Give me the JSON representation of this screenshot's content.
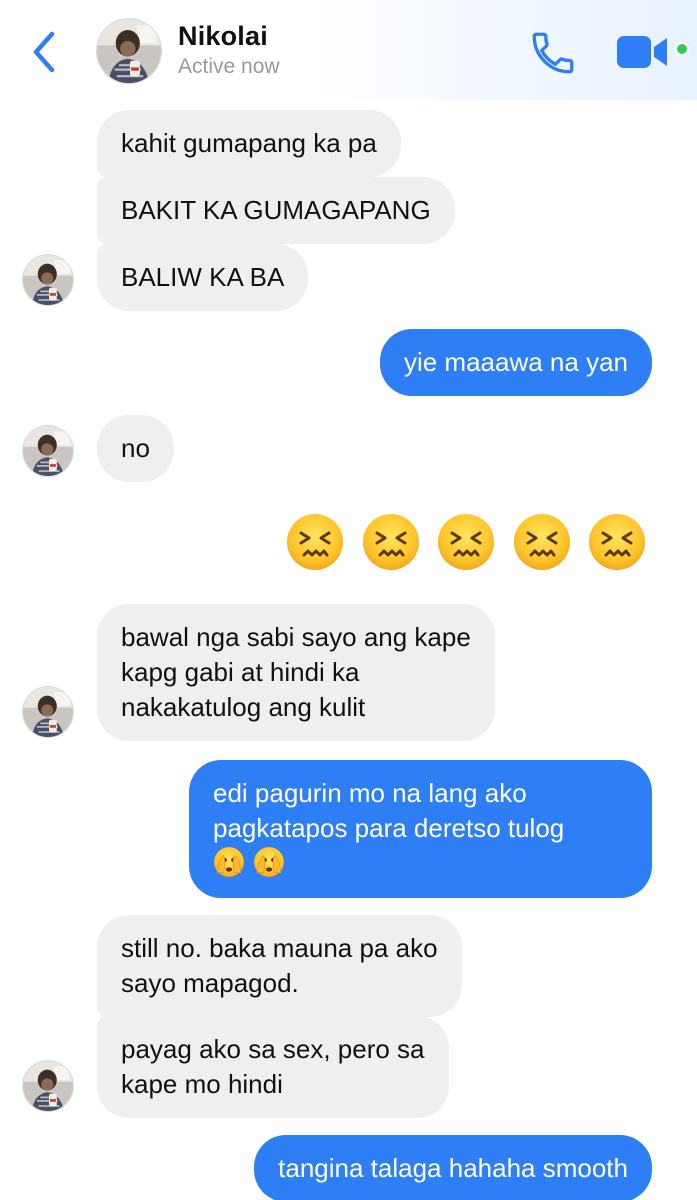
{
  "header": {
    "contact_name": "Nikolai",
    "status": "Active now"
  },
  "colors": {
    "accent": "#2e7ef5",
    "incoming_bubble": "#efefef",
    "online": "#2fcf4c"
  },
  "icons": {
    "back": "chevron-left-icon",
    "call": "phone-icon",
    "video": "video-camera-icon",
    "reaction": "confounded-face-emoji",
    "hands_over_face": "face-with-hands-over-mouth-emoji"
  },
  "messages": [
    {
      "sender": "Nikolai",
      "text": "kahit gumapang ka pa"
    },
    {
      "sender": "Nikolai",
      "text": "BAKIT KA GUMAGAPANG"
    },
    {
      "sender": "Nikolai",
      "text": "BALIW KA BA"
    },
    {
      "sender": "me",
      "text": "yie maaawa na yan"
    },
    {
      "sender": "Nikolai",
      "text": "no"
    },
    {
      "sender": "me",
      "emoji_count": 5
    },
    {
      "sender": "Nikolai",
      "lines": [
        "bawal nga sabi sayo ang kape",
        "kapg gabi at hindi ka",
        "nakakatulog ang kulit"
      ]
    },
    {
      "sender": "me",
      "lines": [
        "edi pagurin mo na lang ako",
        "pagkatapos para deretso tulog"
      ],
      "trailing_emoji_count": 2
    },
    {
      "sender": "Nikolai",
      "lines": [
        "still no. baka mauna pa ako",
        "sayo mapagod."
      ]
    },
    {
      "sender": "Nikolai",
      "lines": [
        "payag ako sa sex, pero sa",
        "kape mo hindi"
      ]
    },
    {
      "sender": "me",
      "text": "tangina talaga hahaha smooth"
    }
  ]
}
